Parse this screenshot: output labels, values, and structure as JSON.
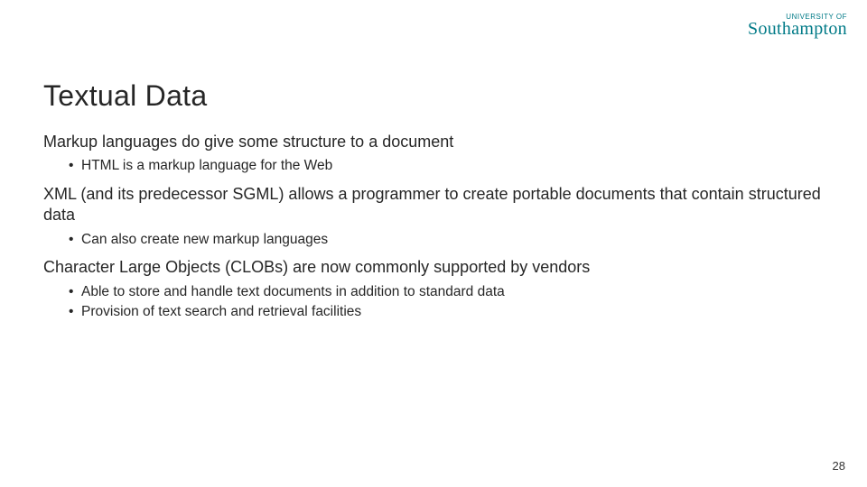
{
  "logo": {
    "small": "UNIVERSITY OF",
    "name": "Southampton"
  },
  "title": "Textual Data",
  "body": {
    "p1": "Markup languages do give some structure to a document",
    "p1_sub": [
      "HTML is a markup language for the Web"
    ],
    "p2": "XML (and its predecessor SGML) allows a programmer to create portable documents that contain structured data",
    "p2_sub": [
      "Can also create new markup languages"
    ],
    "p3": "Character Large Objects (CLOBs) are now commonly supported by vendors",
    "p3_sub": [
      "Able to store and handle text documents in addition to standard data",
      "Provision of text search and retrieval facilities"
    ]
  },
  "page_number": "28"
}
